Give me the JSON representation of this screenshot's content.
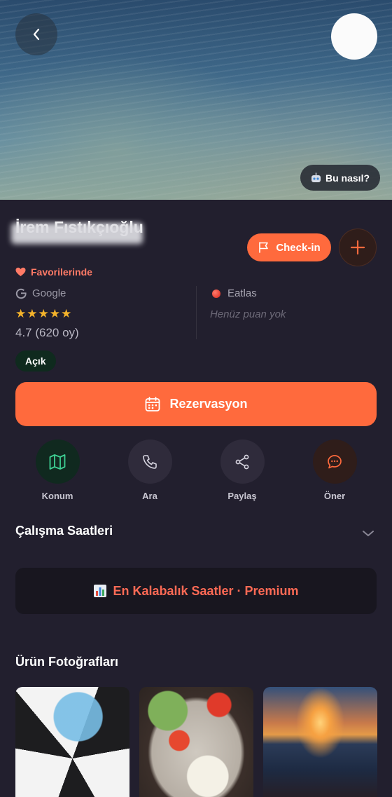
{
  "hero": {
    "how_label": "Bu nasıl?"
  },
  "venue": {
    "name": "İrem Fıstıkçıoğlu"
  },
  "checkin": {
    "label": "Check-in"
  },
  "favorite": {
    "label": "Favorilerinde"
  },
  "ratings": {
    "google": {
      "source": "Google",
      "stars": "★★★★★",
      "score_text": "4.7 (620 oy)"
    },
    "eatlas": {
      "source": "Eatlas",
      "empty_text": "Henüz puan yok"
    }
  },
  "status": {
    "open_label": "Açık"
  },
  "reservation": {
    "label": "Rezervasyon"
  },
  "actions": [
    {
      "label": "Konum",
      "icon": "map-icon"
    },
    {
      "label": "Ara",
      "icon": "phone-icon"
    },
    {
      "label": "Paylaş",
      "icon": "share-icon"
    },
    {
      "label": "Öner",
      "icon": "chat-icon"
    }
  ],
  "hours": {
    "title": "Çalışma Saatleri"
  },
  "premium": {
    "label": "En Kalabalık Saatler · Premium"
  },
  "photos": {
    "title": "Ürün Fotoğrafları"
  },
  "colors": {
    "accent": "#ff6a3d",
    "background": "#221f2e",
    "star": "#f4b32b"
  }
}
